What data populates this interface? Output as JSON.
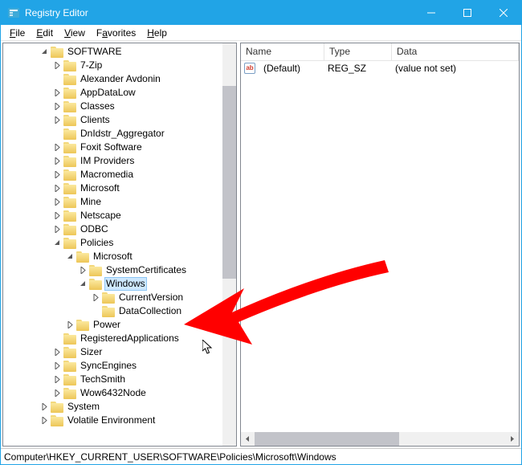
{
  "titlebar": {
    "title": "Registry Editor"
  },
  "menu": {
    "file": "File",
    "edit": "Edit",
    "view": "View",
    "favorites": "Favorites",
    "help": "Help"
  },
  "tree": {
    "software": "SOFTWARE",
    "items_a": [
      {
        "label": "7-Zip",
        "exp": "closed"
      },
      {
        "label": "Alexander Avdonin",
        "exp": "none"
      },
      {
        "label": "AppDataLow",
        "exp": "closed"
      },
      {
        "label": "Classes",
        "exp": "closed"
      },
      {
        "label": "Clients",
        "exp": "closed"
      },
      {
        "label": "DnIdstr_Aggregator",
        "exp": "none"
      },
      {
        "label": "Foxit Software",
        "exp": "closed"
      },
      {
        "label": "IM Providers",
        "exp": "closed"
      },
      {
        "label": "Macromedia",
        "exp": "closed"
      },
      {
        "label": "Microsoft",
        "exp": "closed"
      },
      {
        "label": "Mine",
        "exp": "closed"
      },
      {
        "label": "Netscape",
        "exp": "closed"
      },
      {
        "label": "ODBC",
        "exp": "closed"
      }
    ],
    "policies": "Policies",
    "microsoft2": "Microsoft",
    "syscert": "SystemCertificates",
    "windows": "Windows",
    "curver": "CurrentVersion",
    "datacol": "DataCollection",
    "power": "Power",
    "items_b": [
      {
        "label": "RegisteredApplications",
        "exp": "none"
      },
      {
        "label": "Sizer",
        "exp": "closed"
      },
      {
        "label": "SyncEngines",
        "exp": "closed"
      },
      {
        "label": "TechSmith",
        "exp": "closed"
      },
      {
        "label": "Wow6432Node",
        "exp": "closed"
      }
    ],
    "system": "System",
    "volenv": "Volatile Environment"
  },
  "list": {
    "cols": {
      "name": "Name",
      "type": "Type",
      "data": "Data"
    },
    "row0": {
      "name": "(Default)",
      "type": "REG_SZ",
      "data": "(value not set)"
    }
  },
  "statusbar": {
    "path": "Computer\\HKEY_CURRENT_USER\\SOFTWARE\\Policies\\Microsoft\\Windows"
  }
}
